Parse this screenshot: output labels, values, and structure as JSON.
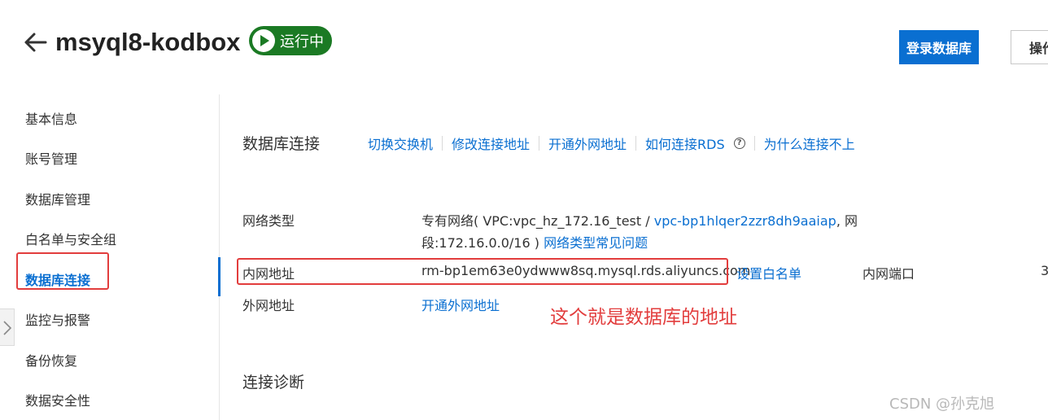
{
  "header": {
    "instance_name": "msyql8-kodbox",
    "status": "运行中",
    "login_db_button": "登录数据库",
    "ops_button": "操作"
  },
  "sidebar": {
    "items": [
      {
        "label": "基本信息"
      },
      {
        "label": "账号管理"
      },
      {
        "label": "数据库管理"
      },
      {
        "label": "白名单与安全组"
      },
      {
        "label": "数据库连接",
        "active": true
      },
      {
        "label": "监控与报警"
      },
      {
        "label": "备份恢复"
      },
      {
        "label": "数据安全性"
      }
    ]
  },
  "connection": {
    "title": "数据库连接",
    "actions": [
      "切换交换机",
      "修改连接地址",
      "开通外网地址",
      "如何连接RDS",
      "为什么连接不上"
    ],
    "network_type_label": "网络类型",
    "network_type_value_prefix": "专有网络( VPC:vpc_hz_172.16_test /",
    "vpc_id_link": "vpc-bp1hlqer2zzr8dh9aaiap",
    "network_type_value_suffix": ", 网",
    "network_segment": "段:172.16.0.0/16 )",
    "network_faq_link": "网络类型常见问题",
    "internal_address_label": "内网地址",
    "internal_address_value": "rm-bp1em63e0ydwww8sq.mysql.rds.aliyuncs.com",
    "set_whitelist_link": "设置白名单",
    "internal_port_label": "内网端口",
    "internal_port_value": "3",
    "external_address_label": "外网地址",
    "open_external_link": "开通外网地址"
  },
  "annotation": "这个就是数据库的地址",
  "diagnosis": {
    "title": "连接诊断"
  },
  "watermark": "CSDN @孙克旭",
  "colors": {
    "accent": "#0a6fd1",
    "status_green": "#1b7a24",
    "annotation_red": "#e23d3d"
  }
}
